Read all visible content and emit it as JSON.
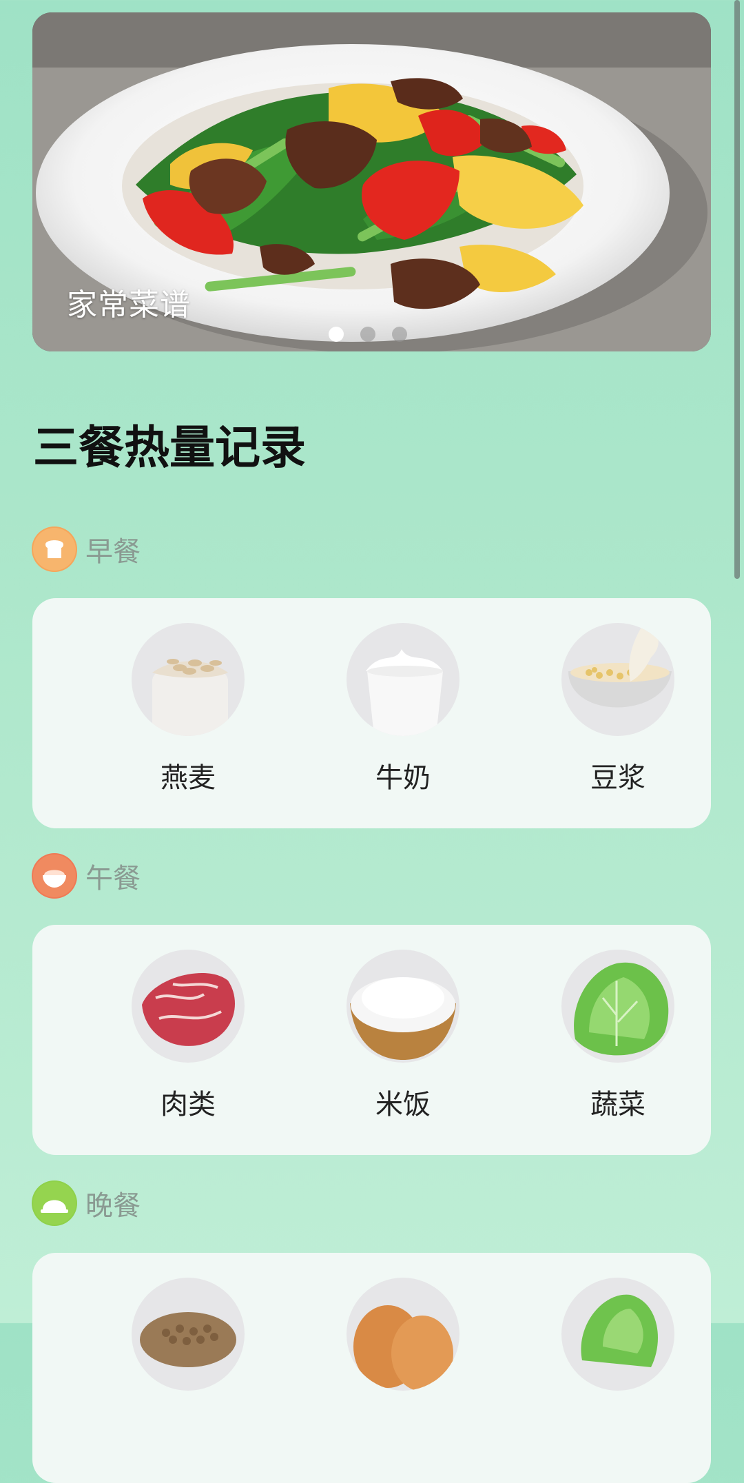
{
  "banner": {
    "title": "家常菜谱",
    "slide_count": 3,
    "active_slide": 1
  },
  "page_title": "三餐热量记录",
  "meals": [
    {
      "label": "早餐",
      "icon": "bread-icon",
      "icon_color": "#f6a55a",
      "items": [
        {
          "label": "燕麦",
          "image": "oats-image"
        },
        {
          "label": "牛奶",
          "image": "milk-image"
        },
        {
          "label": "豆浆",
          "image": "soy-milk-image"
        }
      ]
    },
    {
      "label": "午餐",
      "icon": "rice-bowl-icon",
      "icon_color": "#f07a55",
      "items": [
        {
          "label": "肉类",
          "image": "meat-image"
        },
        {
          "label": "米饭",
          "image": "rice-image"
        },
        {
          "label": "蔬菜",
          "image": "vegetable-image"
        }
      ]
    },
    {
      "label": "晚餐",
      "icon": "dome-icon",
      "icon_color": "#8fd14a",
      "items": [
        {
          "label": "",
          "image": "grains-image"
        },
        {
          "label": "",
          "image": "egg-image"
        },
        {
          "label": "",
          "image": "greens-image"
        }
      ]
    }
  ]
}
